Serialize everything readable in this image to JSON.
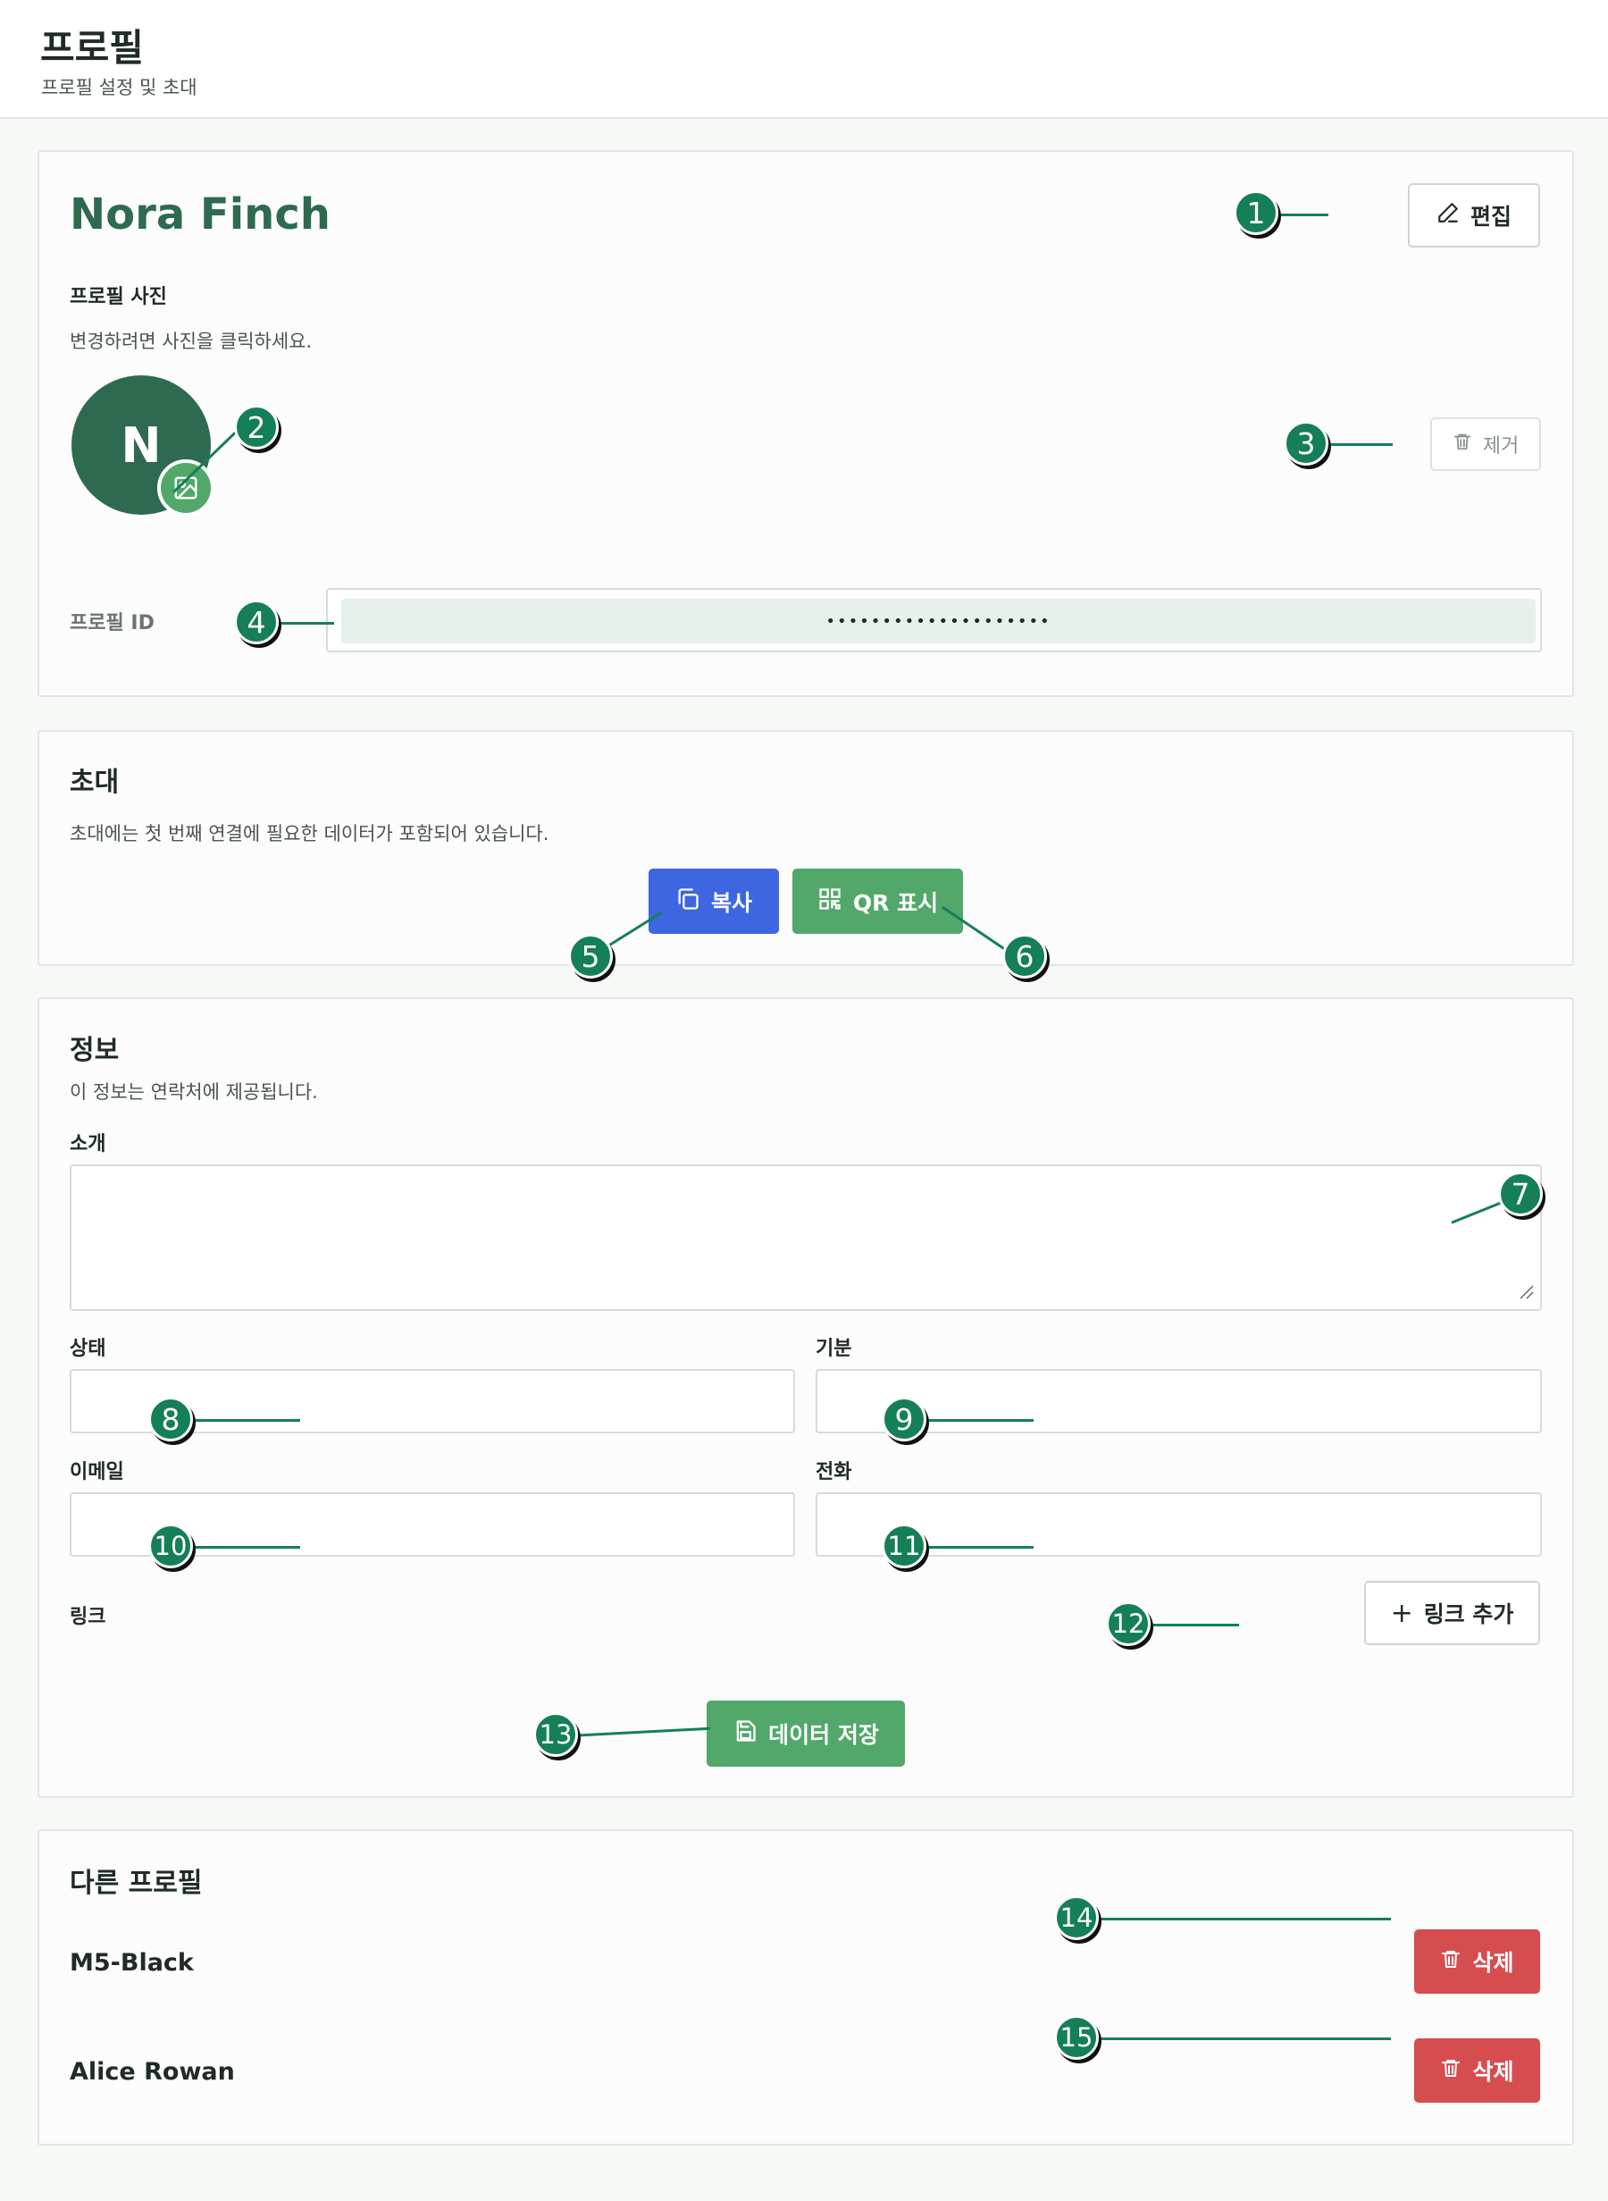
{
  "header": {
    "title": "프로필",
    "subtitle": "프로필 설정 및 초대"
  },
  "profile": {
    "name": "Nora Finch",
    "edit_label": "편집",
    "photo_label": "프로필 사진",
    "photo_hint": "변경하려면 사진을 클릭하세요.",
    "avatar_initial": "N",
    "remove_label": "제거",
    "id_label": "프로필 ID",
    "id_value": "••••••••••••••••••••"
  },
  "invite": {
    "title": "초대",
    "desc": "초대에는 첫 번째 연결에 필요한 데이터가 포함되어 있습니다.",
    "copy_label": "복사",
    "qr_label": "QR 표시"
  },
  "info": {
    "title": "정보",
    "desc": "이 정보는 연락처에 제공됩니다.",
    "intro_label": "소개",
    "status_label": "상태",
    "mood_label": "기분",
    "email_label": "이메일",
    "phone_label": "전화",
    "links_label": "링크",
    "add_link_label": "링크 추가",
    "save_label": "데이터 저장"
  },
  "other_profiles": {
    "title": "다른 프로필",
    "items": [
      {
        "name": "M5-Black",
        "delete_label": "삭제"
      },
      {
        "name": "Alice Rowan",
        "delete_label": "삭제"
      }
    ]
  },
  "markers": [
    "1",
    "2",
    "3",
    "4",
    "5",
    "6",
    "7",
    "8",
    "9",
    "10",
    "11",
    "12",
    "13",
    "14",
    "15"
  ],
  "colors": {
    "accent": "#2e6a4f",
    "marker": "#157f57",
    "blue": "#3d66e0",
    "green": "#52a86a",
    "red": "#d64d50"
  }
}
